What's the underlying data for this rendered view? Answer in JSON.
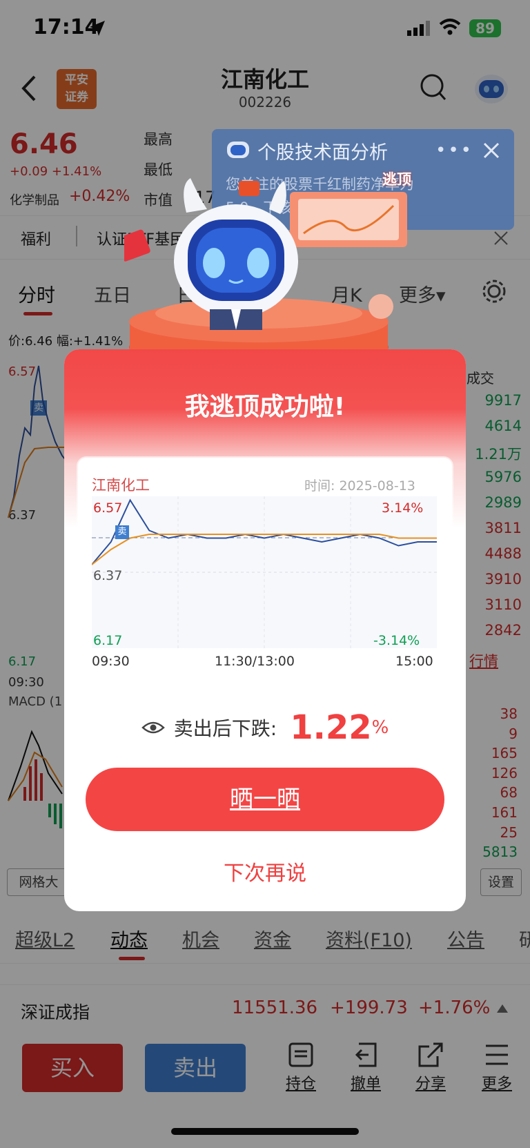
{
  "status": {
    "time": "17:14",
    "battery": "89"
  },
  "header": {
    "title": "江南化工",
    "code": "002226",
    "logo_text": "平安\n证券"
  },
  "quote": {
    "price": "6.46",
    "change": "+0.09",
    "change_pct": "+1.41%",
    "industry": "化学制品",
    "industry_pct": "+0.42%",
    "labels": [
      "最高",
      "最低",
      "市值"
    ],
    "mkt_partial": "17"
  },
  "ticker": {
    "items": [
      "福利",
      "认证ETF基民"
    ]
  },
  "tabs": {
    "items": [
      "分时",
      "五日",
      "日",
      "月K",
      "更多"
    ]
  },
  "chart_info": {
    "label": "价:6.46 幅:+1.41%",
    "y_top": "6.57",
    "y_mid": "6.37",
    "y_bot": "6.17",
    "x_start": "09:30",
    "macd": "MACD (1",
    "grid_btn": "网格大",
    "settings": "设置",
    "sell_badge": "卖"
  },
  "side_volume": {
    "header": "成交",
    "values": [
      "9917",
      "4614",
      "1.21万",
      "5976",
      "2989",
      "3811",
      "4488",
      "3910",
      "3110",
      "2842"
    ],
    "link": "行情"
  },
  "macd_values": [
    "38",
    "9",
    "165",
    "126",
    "68",
    "161",
    "25",
    "5813"
  ],
  "toast": {
    "title": "个股技术面分析",
    "body1": "您关注的股票千红制药净率为",
    "body2": "5.0…下该股…",
    "badge": "逃顶"
  },
  "popup": {
    "title": "我逃顶成功啦!",
    "card_name": "江南化工",
    "card_date_label": "时间:",
    "card_date": "2025-08-13",
    "y_high": "6.57",
    "y_mid": "6.37",
    "y_low": "6.17",
    "pct_high": "3.14%",
    "pct_low": "-3.14%",
    "x_labels": [
      "09:30",
      "11:30/13:00",
      "15:00"
    ],
    "sell_badge": "卖",
    "drop_label": "卖出后下跌:",
    "drop_value": "1.22",
    "drop_unit": "%",
    "share_btn": "晒一晒",
    "later": "下次再说"
  },
  "bottom_tabs": {
    "items": [
      "超级L2",
      "动态",
      "机会",
      "资金",
      "资料(F10)",
      "公告",
      "研"
    ]
  },
  "index_bar": {
    "name": "深证成指",
    "value": "11551.36",
    "change": "+199.73",
    "pct": "+1.76%"
  },
  "toolbar": {
    "buy": "买入",
    "sell": "卖出",
    "position": "持仓",
    "cancel": "撤单",
    "share": "分享",
    "more": "更多"
  },
  "colors": {
    "up": "#d42a2a",
    "down": "#0f9f54",
    "accent": "#f44545",
    "sell_blue": "#3f7fd0"
  },
  "popup_chart": {
    "type": "line",
    "x": [
      "09:30",
      "11:30/13:00",
      "15:00"
    ],
    "ylim": [
      6.17,
      6.57
    ],
    "series": [
      {
        "values": [
          6.39,
          6.45,
          6.56,
          6.48,
          6.46,
          6.47,
          6.46,
          6.46,
          6.47,
          6.46,
          6.47,
          6.46,
          6.45,
          6.46,
          6.47,
          6.46,
          6.44,
          6.45,
          6.45
        ]
      },
      {
        "values": [
          6.39,
          6.43,
          6.46,
          6.47,
          6.47,
          6.47,
          6.47,
          6.47,
          6.47,
          6.47,
          6.47,
          6.47,
          6.47,
          6.47,
          6.47,
          6.47,
          6.46,
          6.46,
          6.46
        ]
      }
    ]
  }
}
